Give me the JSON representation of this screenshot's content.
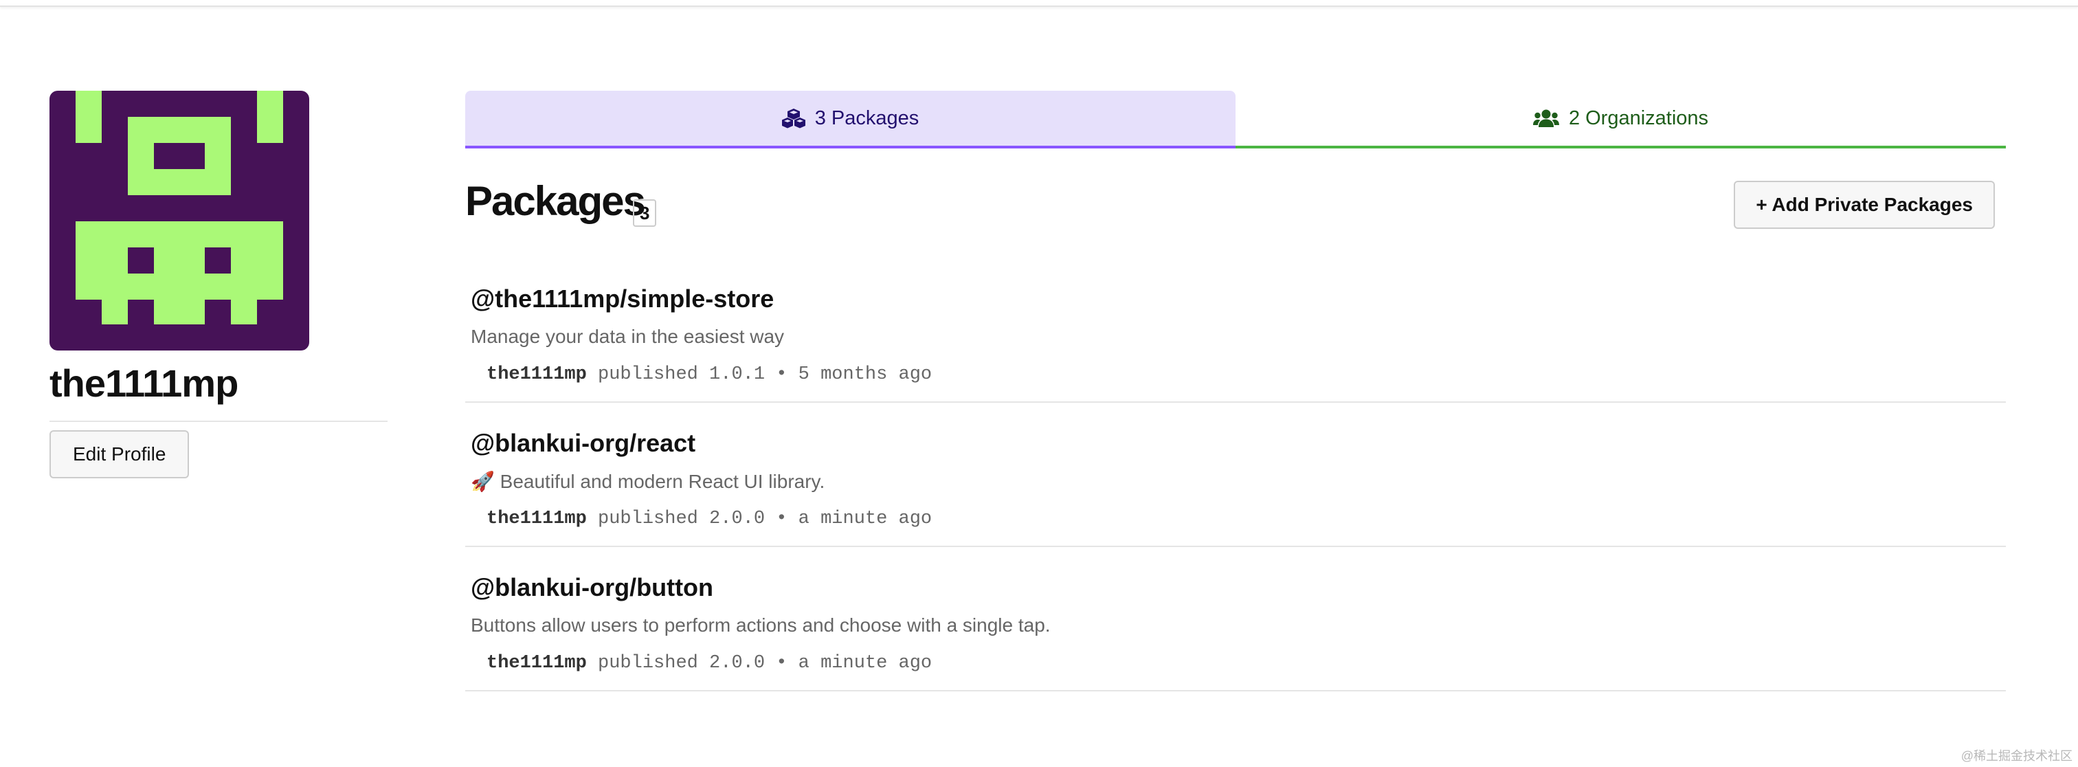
{
  "profile": {
    "username": "the1111mp",
    "edit_profile_label": "Edit Profile",
    "avatar_colors": {
      "background": "#461257",
      "foreground": "#aaf977"
    }
  },
  "tabs": {
    "packages_label": "3 Packages",
    "packages_icon": "cubes-icon",
    "organizations_label": "2 Organizations",
    "organizations_icon": "users-icon",
    "active": "packages",
    "colors": {
      "packages_accent": "#8956ff",
      "packages_bg": "#e6e0fb",
      "organizations_accent": "#4bb543"
    }
  },
  "packages": {
    "title": "Packages",
    "count": "3",
    "add_private_label": "+ Add Private Packages",
    "items": [
      {
        "name": "@the1111mp/simple-store",
        "description": "Manage your data in the easiest way",
        "publisher": "the1111mp",
        "published_text": "published 1.0.1 • 5 months ago"
      },
      {
        "name": "@blankui-org/react",
        "description": "🚀 Beautiful and modern React UI library.",
        "publisher": "the1111mp",
        "published_text": "published 2.0.0 • a minute ago"
      },
      {
        "name": "@blankui-org/button",
        "description": "Buttons allow users to perform actions and choose with a single tap.",
        "publisher": "the1111mp",
        "published_text": "published 2.0.0 • a minute ago"
      }
    ]
  },
  "watermark": "@稀土掘金技术社区"
}
